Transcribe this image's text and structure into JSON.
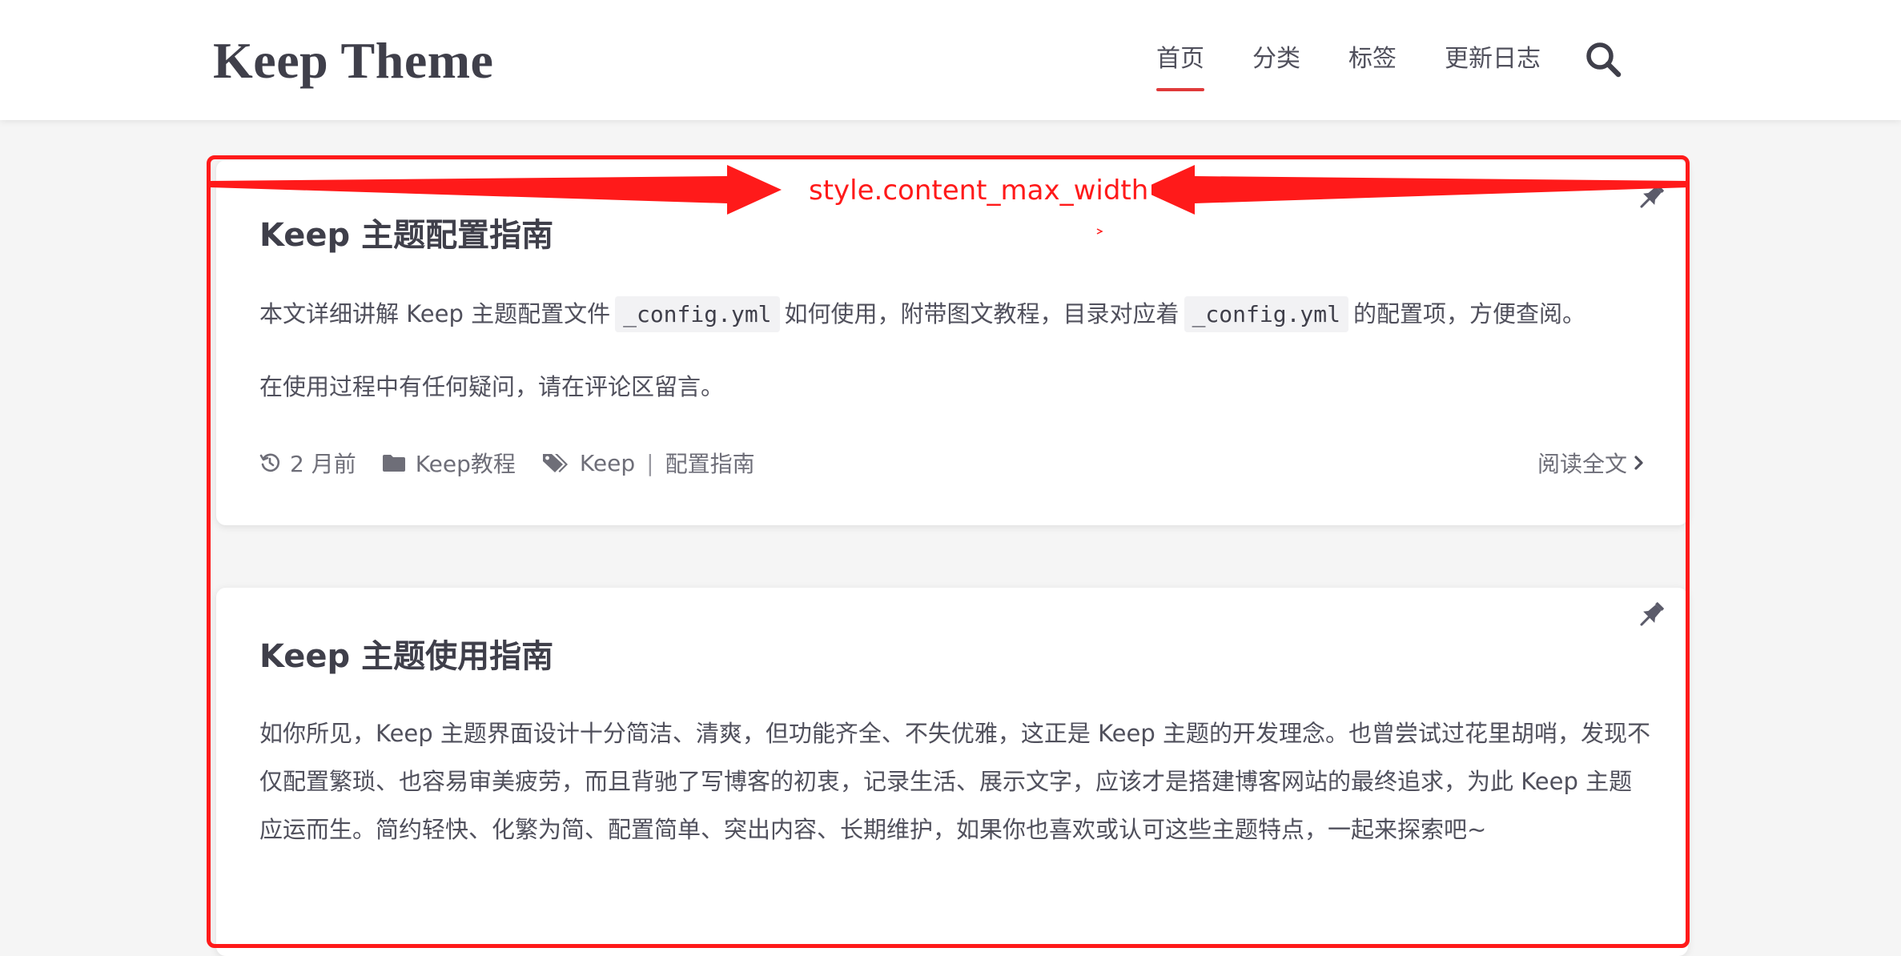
{
  "header": {
    "logo": "Keep Theme",
    "nav": [
      {
        "label": "首页",
        "active": true
      },
      {
        "label": "分类",
        "active": false
      },
      {
        "label": "标签",
        "active": false
      },
      {
        "label": "更新日志",
        "active": false
      }
    ],
    "search_icon": "search-icon"
  },
  "posts": [
    {
      "title": "Keep 主题配置指南",
      "pinned": true,
      "excerpt_p1_a": "本文详细讲解 Keep 主题配置文件",
      "code_1": "_config.yml",
      "excerpt_p1_b": "如何使用，附带图文教程，目录对应着",
      "code_2": "_config.yml",
      "excerpt_p1_c": "的配置项，方便查阅。",
      "excerpt_p2": "在使用过程中有任何疑问，请在评论区留言。",
      "meta": {
        "date": "2 月前",
        "category": "Keep教程",
        "tags": [
          "Keep",
          "配置指南"
        ],
        "tag_separator": "|",
        "read_more": "阅读全文"
      }
    },
    {
      "title": "Keep 主题使用指南",
      "pinned": true,
      "excerpt": "如你所见，Keep 主题界面设计十分简洁、清爽，但功能齐全、不失优雅，这正是 Keep 主题的开发理念。也曾尝试过花里胡哨，发现不仅配置繁琐、也容易审美疲劳，而且背驰了写博客的初衷，记录生活、展示文字，应该才是搭建博客网站的最终追求，为此 Keep 主题应运而生。简约轻快、化繁为简、配置简单、突出内容、长期维护，如果你也喜欢或认可这些主题特点，一起来探索吧~"
    }
  ],
  "annotation": {
    "label": "style.content_max_width",
    "color": "#ff1a1a"
  },
  "colors": {
    "accent": "#e03a3a",
    "text": "#50505c",
    "heading": "#3f3f4a",
    "meta": "#6e6e78",
    "background": "#f5f5f5"
  }
}
